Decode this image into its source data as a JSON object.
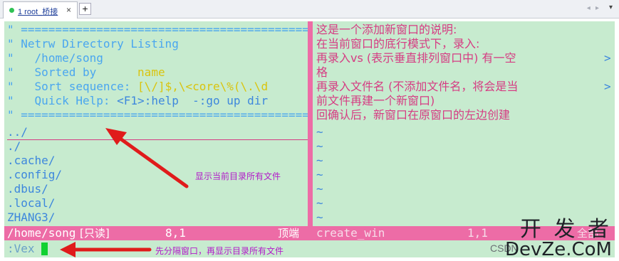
{
  "tab": {
    "label": "1 root_桥接",
    "close": "×",
    "add": "+",
    "status_color": "#2fc254"
  },
  "nav": {
    "arrows": "◂ ▸",
    "menu": "▾"
  },
  "netrw": {
    "rule": "\" ===============================================",
    "title_prefix": "\" ",
    "title": "Netrw Directory Listing",
    "path": "/home/song",
    "sorted_label": "Sorted by",
    "sorted_value": "name",
    "sort_seq_label": "Sort sequence:",
    "sort_seq_value": "[\\/]$,\\<core\\%(\\.\\d",
    "quick_help_label": "Quick Help:",
    "quick_help_value": "<F1>:help  -:go up dir",
    "quote": "\"",
    "entries": [
      "../",
      "./",
      ".cache/",
      ".config/",
      ".dbus/",
      ".local/",
      "ZHANG3/"
    ]
  },
  "right_pane": {
    "lines": [
      "这是一个添加新窗口的说明:",
      "在当前窗口的底行模式下，录入:",
      "再录入vs (表示垂直排列窗口中) 有一空",
      "格",
      "再录入文件名 (不添加文件名，将会是当",
      "前文件再建一个新窗口)",
      "回确认后，新窗口在原窗口的左边创建"
    ],
    "wrap_marker": ">",
    "tilde": "~"
  },
  "status": {
    "left_path": "/home/song",
    "left_readonly": "[只读]",
    "left_pos": "8,1",
    "left_top": "顶端",
    "right_file": "create_win",
    "right_pos": "1,1",
    "right_all": "全部"
  },
  "command": ":Vex",
  "annotations": {
    "list_files": "显示当前目录所有文件",
    "split_then_list": "先分隔窗口，再显示目录所有文件"
  },
  "watermark": {
    "top": "开 发 者",
    "bottom": "DevZe.CoM",
    "csdn": "CSDN"
  },
  "colors": {
    "terminal_bg": "#c7ebcf",
    "comment": "#4aa6ef",
    "value": "#d9c40f",
    "note_text": "#d63c83",
    "status_bar": "#ed6ca6",
    "cursor": "#11d132",
    "arrow": "#e01b1b",
    "annotation": "#b21ac9"
  }
}
